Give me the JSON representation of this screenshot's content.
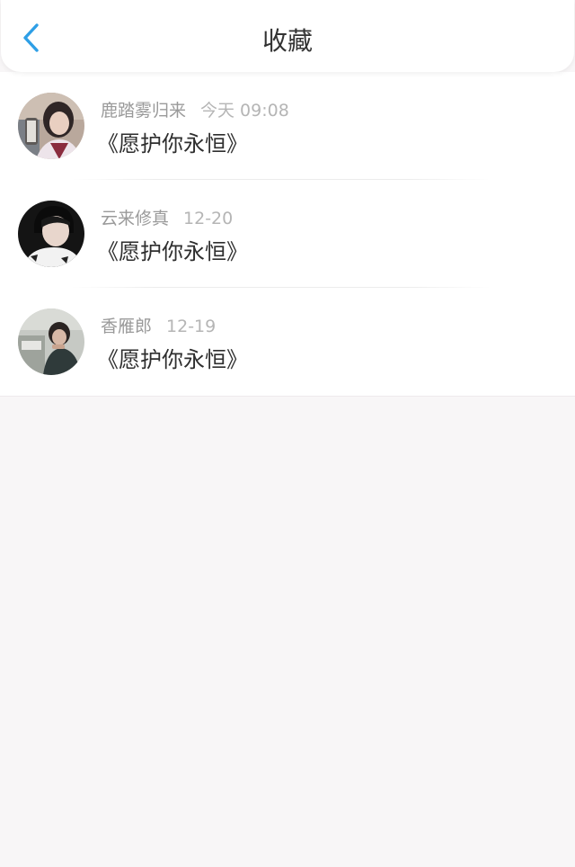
{
  "header": {
    "title": "收藏",
    "back_icon": "chevron-left-icon",
    "accent_color": "#2e9fe6"
  },
  "favorites": [
    {
      "username": "鹿踏雾归来",
      "time": "今天 09:08",
      "content": "《愿护你永恒》"
    },
    {
      "username": "云来修真",
      "time": "12-20",
      "content": "《愿护你永恒》"
    },
    {
      "username": "香雁郎",
      "time": "12-19",
      "content": "《愿护你永恒》"
    }
  ]
}
